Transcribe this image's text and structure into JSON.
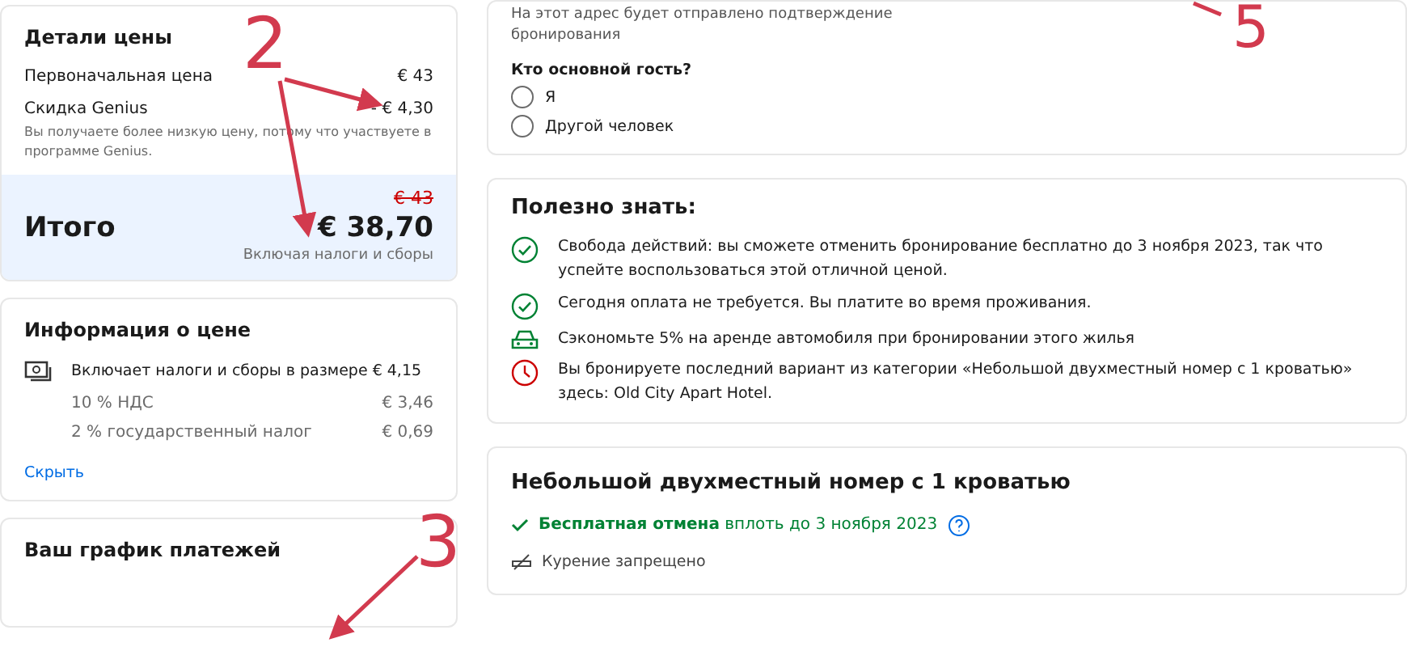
{
  "price_details": {
    "title": "Детали цены",
    "rows": [
      {
        "label": "Первоначальная цена",
        "value": "€ 43"
      },
      {
        "label": "Скидка Genius",
        "value": "- € 4,30"
      }
    ],
    "note": "Вы получаете более низкую цену, потому что участвуете в программе Genius.",
    "total": {
      "label": "Итого",
      "old_price": "€ 43",
      "price": "€ 38,70",
      "caption": "Включая налоги и сборы"
    }
  },
  "price_info": {
    "title": "Информация о цене",
    "summary": "Включает налоги и сборы в размере € 4,15",
    "taxes": [
      {
        "label": "10 % НДС",
        "value": "€ 3,46"
      },
      {
        "label": "2 % государственный налог",
        "value": "€ 0,69"
      }
    ],
    "link": "Скрыть"
  },
  "payment_schedule": {
    "title": "Ваш график платежей"
  },
  "contact": {
    "hint_lines": [
      "На этот адрес будет отправлено подтверждение",
      "бронирования"
    ],
    "question": "Кто основной гость?",
    "options": [
      {
        "label": "Я",
        "selected": false
      },
      {
        "label": "Другой человек",
        "selected": false
      }
    ]
  },
  "good_to_know": {
    "title": "Полезно знать:",
    "items": [
      {
        "kind": "check",
        "text": "Свобода действий: вы сможете отменить бронирование бесплатно до 3 ноября 2023, так что успейте воспользоваться этой отличной ценой."
      },
      {
        "kind": "check",
        "text": "Сегодня оплата не требуется. Вы платите во время проживания."
      },
      {
        "kind": "car",
        "text": "Сэкономьте 5% на аренде автомобиля при бронировании этого жилья"
      },
      {
        "kind": "clock",
        "text": "Вы бронируете последний вариант из категории «Небольшой двухместный номер с 1 кроватью» здесь: Old City Apart Hotel."
      }
    ]
  },
  "room": {
    "title": "Небольшой двухместный номер с 1 кроватью",
    "cancellation": {
      "strong": "Бесплатная отмена",
      "rest": "вплоть до 3 ноября 2023"
    },
    "facilities": [
      "Курение запрещено"
    ]
  },
  "annotations": [
    {
      "number": "2"
    },
    {
      "number": "3"
    },
    {
      "number": "5"
    }
  ]
}
